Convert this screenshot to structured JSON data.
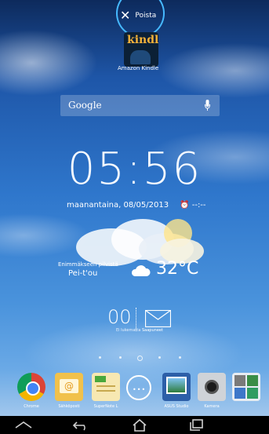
{
  "drag_remove": {
    "label": "Poista"
  },
  "dragged_app": {
    "label": "Amazon Kindle",
    "icon": "kindle-icon"
  },
  "search": {
    "label": "Google",
    "icon": "mic-icon"
  },
  "clock": {
    "time": "05:56",
    "date": "maanantaina, 08/05/2013",
    "alarm": "⏰ --:--"
  },
  "weather": {
    "description": "Enimmäkseen pilvistä",
    "city": "Pei-t'ou",
    "temperature": "32°C",
    "icon": "cloud-icon"
  },
  "email_widget": {
    "count": "00",
    "count_label": "Ei lukematta",
    "inbox_label": "Saapuneet"
  },
  "dock": {
    "items": [
      {
        "label": "Chrome",
        "icon": "chrome-icon"
      },
      {
        "label": "Sähköposti",
        "icon": "email-icon"
      },
      {
        "label": "SuperNote L",
        "icon": "supernote-icon"
      },
      {
        "label": "",
        "icon": "all-apps-icon"
      },
      {
        "label": "ASUS Studio",
        "icon": "asus-studio-icon"
      },
      {
        "label": "Kamera",
        "icon": "camera-icon"
      },
      {
        "label": "",
        "icon": "google-apps-folder-icon"
      }
    ]
  },
  "nav": {
    "buttons": [
      "hide-keyboard-icon",
      "back-icon",
      "home-icon",
      "recent-apps-icon"
    ]
  },
  "colors": {
    "accent_ring": "#46b9ff",
    "nav_bar": "#000000"
  }
}
